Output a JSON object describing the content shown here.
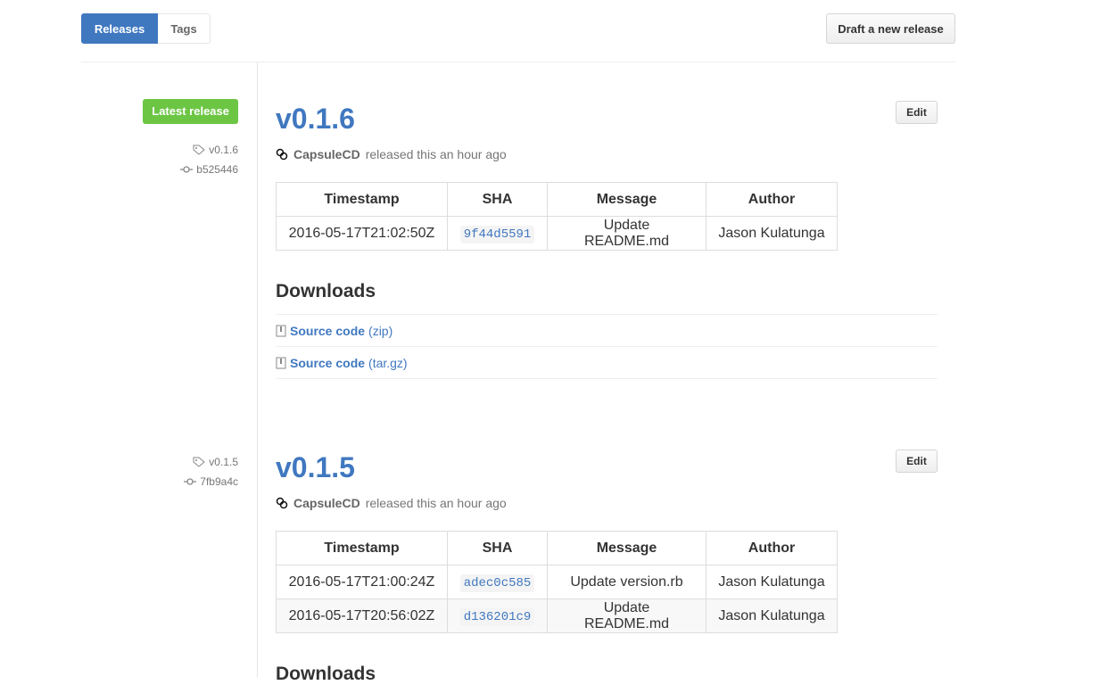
{
  "subnav": {
    "releases_label": "Releases",
    "tags_label": "Tags"
  },
  "draft_button": "Draft a new release",
  "colors": {
    "accent": "#4078c0",
    "latest_badge": "#6cc644"
  },
  "icons": {
    "tag": "tag-icon",
    "commit": "commit-icon",
    "avatar": "capsulecd-avatar-icon",
    "zip": "file-zip-icon"
  },
  "releases": [
    {
      "latest_label": "Latest release",
      "tag": "v0.1.6",
      "commit": "b525446",
      "title": "v0.1.6",
      "edit_label": "Edit",
      "author": "CapsuleCD",
      "released_text": "released this an hour ago",
      "table": {
        "headers": [
          "Timestamp",
          "SHA",
          "Message",
          "Author"
        ],
        "rows": [
          [
            "2016-05-17T21:02:50Z",
            "9f44d5591",
            "Update README.md",
            "Jason Kulatunga"
          ]
        ]
      },
      "downloads_title": "Downloads",
      "downloads": [
        {
          "label": "Source code",
          "ext": "(zip)"
        },
        {
          "label": "Source code",
          "ext": "(tar.gz)"
        }
      ]
    },
    {
      "tag": "v0.1.5",
      "commit": "7fb9a4c",
      "title": "v0.1.5",
      "edit_label": "Edit",
      "author": "CapsuleCD",
      "released_text": "released this an hour ago",
      "table": {
        "headers": [
          "Timestamp",
          "SHA",
          "Message",
          "Author"
        ],
        "rows": [
          [
            "2016-05-17T21:00:24Z",
            "adec0c585",
            "Update version.rb",
            "Jason Kulatunga"
          ],
          [
            "2016-05-17T20:56:02Z",
            "d136201c9",
            "Update README.md",
            "Jason Kulatunga"
          ]
        ]
      },
      "downloads_title": "Downloads"
    }
  ]
}
